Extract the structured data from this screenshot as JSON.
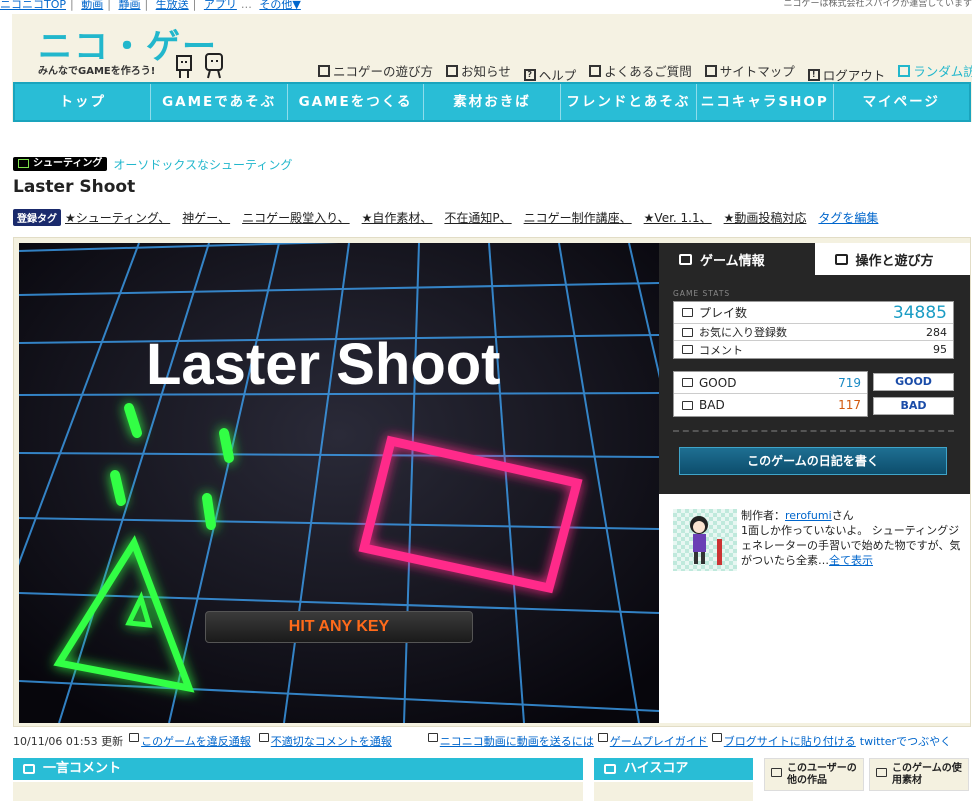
{
  "topbar": {
    "items": [
      "ニコニコTOP",
      "動画",
      "静画",
      "生放送",
      "アプリ"
    ],
    "more": "その他▼",
    "right_text": "ニコゲーは株式会社スパイクが運営しています"
  },
  "logo": {
    "main": "ニコ・ゲー",
    "sub": "みんなでGAMEを作ろう!"
  },
  "utilnav": [
    "ニコゲーの遊び方",
    "お知らせ",
    "ヘルプ",
    "よくあるご質問",
    "サイトマップ",
    "ログアウト",
    "ランダム訪問"
  ],
  "mainnav": [
    "トップ",
    "GAMEであそぶ",
    "GAMEをつくる",
    "素材おきば",
    "フレンドとあそぶ",
    "ニコキャラSHOP",
    "マイページ"
  ],
  "genre": {
    "badge": "シューティング",
    "desc": "オーソドックスなシューティング"
  },
  "game_title": "Laster Shoot",
  "tags": {
    "label": "登録タグ",
    "items": [
      "★シューティング、",
      "神ゲー、",
      "ニコゲー殿堂入り、",
      "★自作素材、",
      "不在通知P、",
      "ニコゲー制作講座、",
      "★Ver. 1.1、",
      "★動画投稿対応"
    ],
    "edit": "タグを編集"
  },
  "screen": {
    "title": "Laster Shoot",
    "prompt": "HIT ANY KEY"
  },
  "side": {
    "tabs": [
      "ゲーム情報",
      "操作と遊び方"
    ],
    "stats_label": "GAME STATS",
    "plays_label": "プレイ数",
    "plays": "34885",
    "favorites_label": "お気に入り登録数",
    "favorites": "284",
    "comments_label": "コメント",
    "comments": "95",
    "good_label": "GOOD",
    "good": "719",
    "bad_label": "BAD",
    "bad": "117",
    "good_button": "GOOD",
    "bad_button": "BAD",
    "diary_button": "このゲームの日記を書く",
    "creator_prefix": "制作者：",
    "creator_name": "rerofumi",
    "creator_suffix": "さん",
    "creator_text": "1面しか作っていないよ。 シューティングジェネレーターの手習いで始めた物ですが、気がついたら全素…",
    "show_all": "全て表示"
  },
  "footline": {
    "updated": "10/11/06 01:53 更新",
    "report_game": "このゲームを違反通報",
    "report_comment": "不適切なコメントを通報",
    "send_video": "ニコニコ動画に動画を送るには",
    "play_guide": "ゲームプレイガイド",
    "blog": "ブログサイトに貼り付ける",
    "twitter": "twitterでつぶやく"
  },
  "sections": {
    "comment": "一言コメント",
    "hiscore": "ハイスコア",
    "other_works": "このユーザーの他の作品",
    "materials": "このゲームの使用素材"
  },
  "colors": {
    "accent": "#29bdd6",
    "neon_green": "#33ff44",
    "neon_pink": "#ff2a8a"
  }
}
